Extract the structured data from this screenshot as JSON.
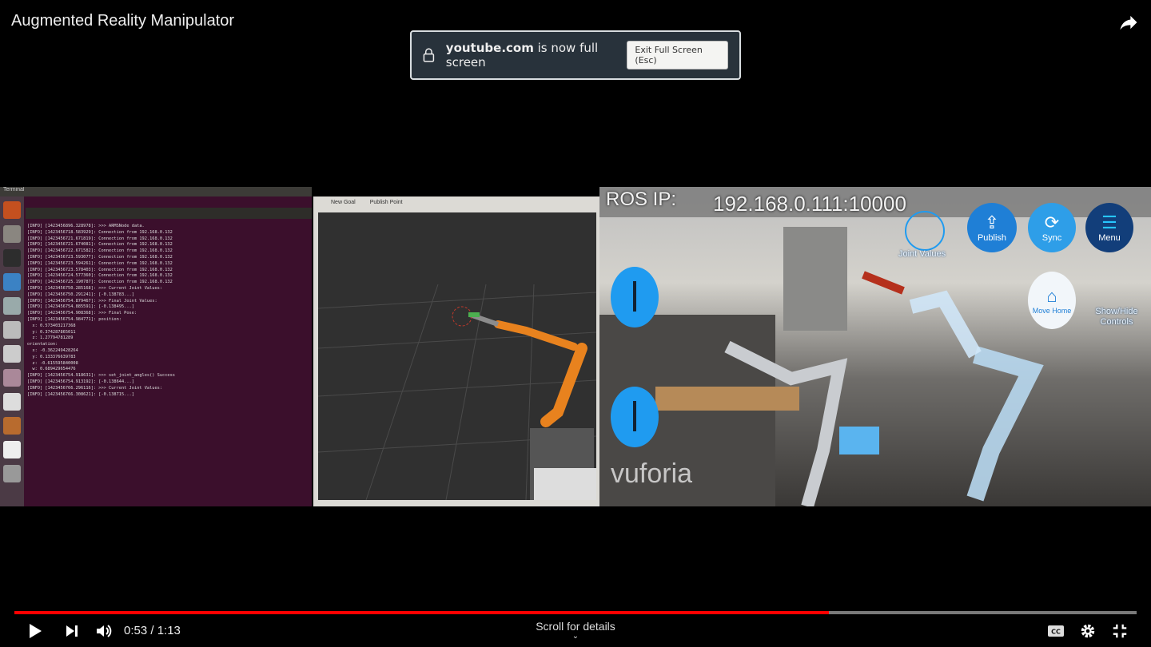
{
  "video": {
    "title": "Augmented Reality Manipulator"
  },
  "fullscreen_notice": {
    "domain": "youtube.com",
    "message": "is now full screen",
    "exit_label": "Exit Full Screen (Esc)"
  },
  "frame": {
    "terminal": {
      "title": "Terminal",
      "lines": [
        "[INFO] [1423456896.328978]: >>> ARMSNode data.",
        "[INFO] [1423456718.583929]: Connection from 192.168.0.132",
        "[INFO] [1423456721.671819]: Connection from 192.168.0.132",
        "[INFO] [1423456721.674081]: Connection from 192.168.0.132",
        "[INFO] [1423456722.671582]: Connection from 192.168.0.132",
        "[INFO] [1423456723.593077]: Connection from 192.168.0.132",
        "[INFO] [1423456723.594261]: Connection from 192.168.0.132",
        "[INFO] [1423456723.578403]: Connection from 192.168.0.132",
        "[INFO] [1423456724.577360]: Connection from 192.168.0.132",
        "[INFO] [1423456725.190787]: Connection from 192.168.0.132",
        "[INFO] [1423456750.285168]: >>> Current Joint Values:",
        "[INFO] [1423456750.291241]: [-0.138783...]",
        "[INFO] [1423456754.879467]: >>> Final Joint Values:",
        "[INFO] [1423456754.885591]: [-0.138495...]",
        "[INFO] [1423456754.908368]: >>> Final Pose:",
        "[INFO] [1423456754.984771]: position:",
        "  x: 0.573403217368",
        "  y: 0.374287865011",
        "  z: 1.27794781289",
        "orientation:",
        "  x: -0.362249428264",
        "  y: 0.133376639783",
        "  z: -0.615595840008",
        "  w: 0.689429654476",
        "[INFO] [1423456754.918631]: >>> set_joint_angles() Success",
        "[INFO] [1423456754.913192]: [-0.138644...]",
        "[INFO] [1423456766.296116]: >>> Current Joint Values:",
        "[INFO] [1423456766.308621]: [-0.138715...]"
      ]
    },
    "rviz": {
      "toolbar": [
        "New Goal",
        "Publish Point"
      ]
    },
    "ar_app": {
      "ros_ip_label": "ROS IP:",
      "ros_ip_value": "192.168.0.111:10000",
      "buttons": [
        "Joint Values",
        "Publish",
        "Sync",
        "Menu",
        "Move Home",
        "Show/Hide Controls"
      ],
      "watermark": "vuforia"
    }
  },
  "player": {
    "progress_percent": 72.6,
    "current_time": "0:53",
    "duration": "1:13",
    "time_display": "0:53 / 1:13",
    "scroll_hint": "Scroll for details",
    "colors": {
      "progress": "#ff0000",
      "buffer": "#7a7a7a"
    }
  }
}
